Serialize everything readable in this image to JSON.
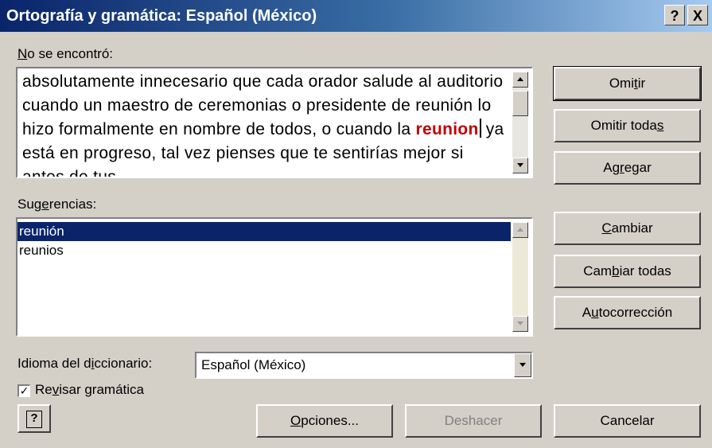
{
  "window": {
    "title": "Ortografía y gramática: Español (México)",
    "help_button": "?",
    "close_button": "X"
  },
  "not_found": {
    "label": "No se encontró:",
    "text_before": "absolutamente innecesario que cada orador salude al auditorio cuando un maestro de ceremonias o presidente de reunión lo hizo formalmente en nombre de todos, o cuando la ",
    "flagged_word": "reunion",
    "text_after": " ya está en progreso, tal vez pienses que te sentirías mejor si antes de tus"
  },
  "suggestions": {
    "label": "Sugerencias:",
    "items": [
      "reunión",
      "reunios"
    ],
    "selected_index": 0
  },
  "dictionary": {
    "label": "Idioma del diccionario:",
    "value": "Español (México)"
  },
  "grammar_check": {
    "label": "Revisar gramática",
    "checked": true
  },
  "buttons": {
    "ignore": "Omitir",
    "ignore_all": "Omitir todas",
    "add": "Agregar",
    "change": "Cambiar",
    "change_all": "Cambiar todas",
    "autocorrect": "Autocorrección",
    "options": "Opciones...",
    "undo": "Deshacer",
    "cancel": "Cancelar",
    "help_icon_label": "?"
  },
  "colors": {
    "dialog_bg": "#d4d0c8",
    "title_start": "#0a246a",
    "selection": "#0a246a",
    "flagged_word": "#c00000"
  }
}
